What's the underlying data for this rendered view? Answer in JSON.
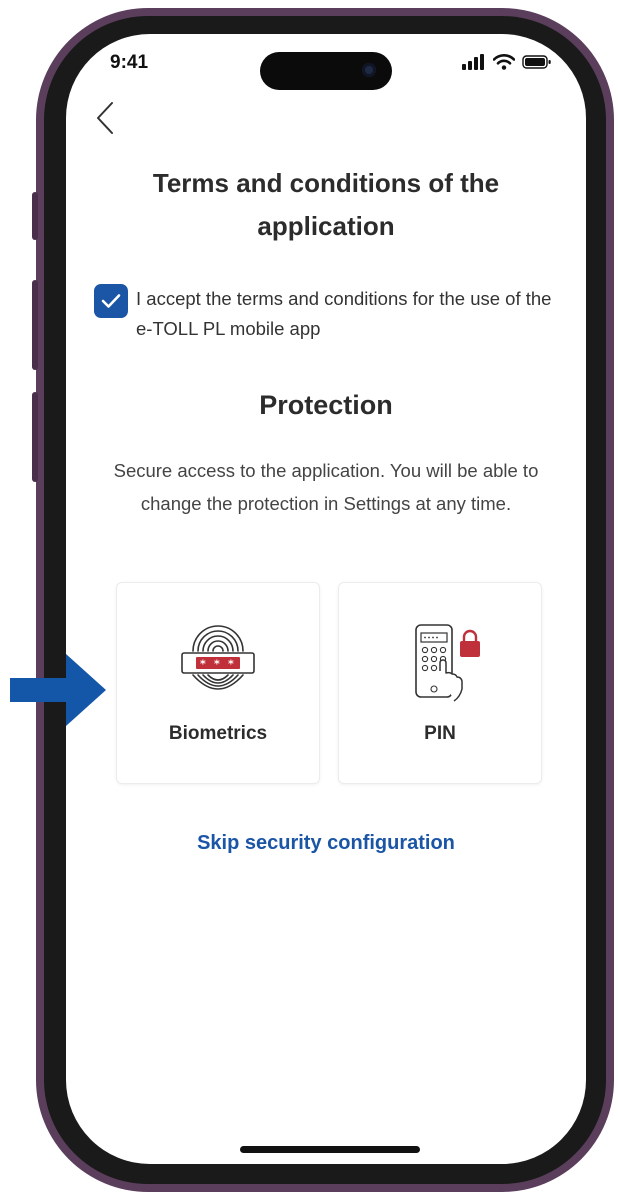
{
  "status_bar": {
    "time": "9:41"
  },
  "header": {
    "title": "Terms and conditions of the application"
  },
  "terms": {
    "checked": true,
    "label": "I accept the terms and conditions for the use of the e-TOLL PL mobile app"
  },
  "protection": {
    "title": "Protection",
    "description": "Secure access to the application. You will be able to change the protection in Settings at any time.",
    "options": [
      {
        "label": "Biometrics",
        "icon": "fingerprint-icon"
      },
      {
        "label": "PIN",
        "icon": "phone-pin-icon"
      }
    ]
  },
  "skip_link": "Skip security configuration",
  "colors": {
    "accent": "#1a55a6",
    "pointer": "#1457a8",
    "lock": "#c0303a",
    "frame": "#5a3e5c"
  }
}
